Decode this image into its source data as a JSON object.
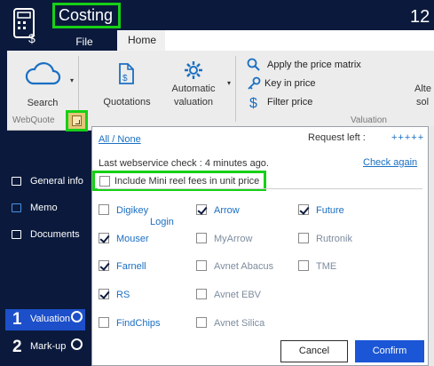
{
  "app": {
    "title": "Costing",
    "title_right": "12",
    "logo_icon": "calculator-dollar-icon"
  },
  "tabs": [
    {
      "label": "File"
    },
    {
      "label": "Home"
    }
  ],
  "ribbon": {
    "search_label": "Search",
    "webquote_group": "WebQuote",
    "quotations_label": "Quotations",
    "automatic_valuation_line1": "Automatic",
    "automatic_valuation_line2": "valuation",
    "apply_price_matrix": "Apply the price matrix",
    "key_in_price": "Key in price",
    "filter_price": "Filter price",
    "valuation_group": "Valuation",
    "alternative_line1": "Alte",
    "alternative_line2": "sol"
  },
  "sidebar": {
    "items": [
      {
        "label": "General info",
        "icon": "info-icon"
      },
      {
        "label": "Memo",
        "icon": "memo-icon"
      },
      {
        "label": "Documents",
        "icon": "folder-icon"
      }
    ],
    "steps": [
      {
        "num": "1",
        "label": "Valuation"
      },
      {
        "num": "2",
        "label": "Mark-up"
      }
    ]
  },
  "dialog": {
    "all_none": "All / None",
    "request_left_label": "Request left :",
    "request_left_value": "+++++",
    "last_check": "Last webservice check : 4 minutes ago.",
    "check_again": "Check again",
    "mini_reel_label": "Include Mini reel fees in unit price",
    "mini_reel_checked": false,
    "login_label": "Login",
    "providers": [
      {
        "name": "Digikey",
        "checked": false,
        "active": true
      },
      {
        "name": "Arrow",
        "checked": true,
        "active": true
      },
      {
        "name": "Future",
        "checked": true,
        "active": true
      },
      {
        "name": "Mouser",
        "checked": true,
        "active": true
      },
      {
        "name": "MyArrow",
        "checked": false,
        "active": false
      },
      {
        "name": "Rutronik",
        "checked": false,
        "active": false
      },
      {
        "name": "Farnell",
        "checked": true,
        "active": true
      },
      {
        "name": "Avnet Abacus",
        "checked": false,
        "active": false
      },
      {
        "name": "TME",
        "checked": false,
        "active": false
      },
      {
        "name": "RS",
        "checked": true,
        "active": true
      },
      {
        "name": "Avnet EBV",
        "checked": false,
        "active": false
      },
      {
        "name": "FindChips",
        "checked": false,
        "active": true
      },
      {
        "name": "Avnet Silica",
        "checked": false,
        "active": false
      }
    ],
    "cancel_label": "Cancel",
    "confirm_label": "Confirm"
  },
  "colors": {
    "background": "#0b1a3c",
    "highlight": "#16d016",
    "link": "#1a6fc2",
    "primary_button": "#1a56d6"
  }
}
